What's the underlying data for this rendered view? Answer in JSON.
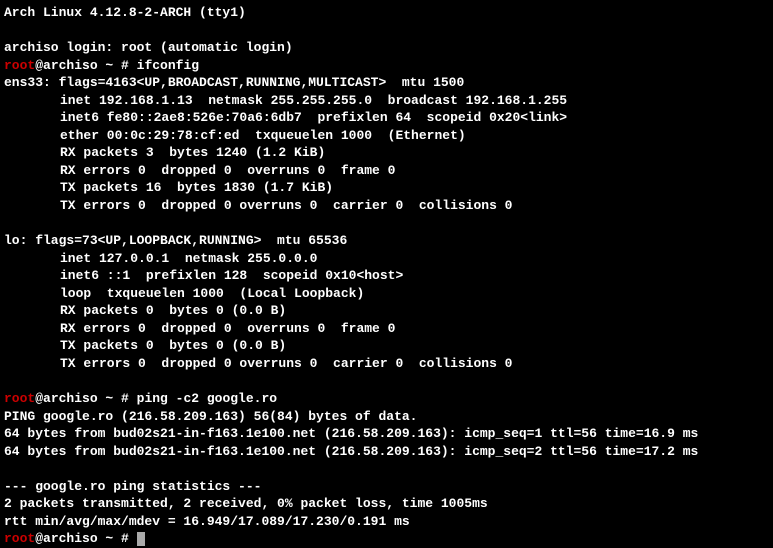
{
  "header": "Arch Linux 4.12.8-2-ARCH (tty1)",
  "login_line": "archiso login: root (automatic login)",
  "prompt1_user": "root",
  "prompt1_rest": "@archiso ~ # ",
  "cmd1": "ifconfig",
  "ifconfig_ens33_header": "ens33: flags=4163<UP,BROADCAST,RUNNING,MULTICAST>  mtu 1500",
  "ifconfig_ens33_inet": "inet 192.168.1.13  netmask 255.255.255.0  broadcast 192.168.1.255",
  "ifconfig_ens33_inet6": "inet6 fe80::2ae8:526e:70a6:6db7  prefixlen 64  scopeid 0x20<link>",
  "ifconfig_ens33_ether": "ether 00:0c:29:78:cf:ed  txqueuelen 1000  (Ethernet)",
  "ifconfig_ens33_rxpackets": "RX packets 3  bytes 1240 (1.2 KiB)",
  "ifconfig_ens33_rxerrors": "RX errors 0  dropped 0  overruns 0  frame 0",
  "ifconfig_ens33_txpackets": "TX packets 16  bytes 1830 (1.7 KiB)",
  "ifconfig_ens33_txerrors": "TX errors 0  dropped 0 overruns 0  carrier 0  collisions 0",
  "ifconfig_lo_header": "lo: flags=73<UP,LOOPBACK,RUNNING>  mtu 65536",
  "ifconfig_lo_inet": "inet 127.0.0.1  netmask 255.0.0.0",
  "ifconfig_lo_inet6": "inet6 ::1  prefixlen 128  scopeid 0x10<host>",
  "ifconfig_lo_loop": "loop  txqueuelen 1000  (Local Loopback)",
  "ifconfig_lo_rxpackets": "RX packets 0  bytes 0 (0.0 B)",
  "ifconfig_lo_rxerrors": "RX errors 0  dropped 0  overruns 0  frame 0",
  "ifconfig_lo_txpackets": "TX packets 0  bytes 0 (0.0 B)",
  "ifconfig_lo_txerrors": "TX errors 0  dropped 0 overruns 0  carrier 0  collisions 0",
  "cmd2": "ping -c2 google.ro",
  "ping_header": "PING google.ro (216.58.209.163) 56(84) bytes of data.",
  "ping_reply1": "64 bytes from bud02s21-in-f163.1e100.net (216.58.209.163): icmp_seq=1 ttl=56 time=16.9 ms",
  "ping_reply2": "64 bytes from bud02s21-in-f163.1e100.net (216.58.209.163): icmp_seq=2 ttl=56 time=17.2 ms",
  "ping_stats_header": "--- google.ro ping statistics ---",
  "ping_stats_summary": "2 packets transmitted, 2 received, 0% packet loss, time 1005ms",
  "ping_stats_rtt": "rtt min/avg/max/mdev = 16.949/17.089/17.230/0.191 ms"
}
